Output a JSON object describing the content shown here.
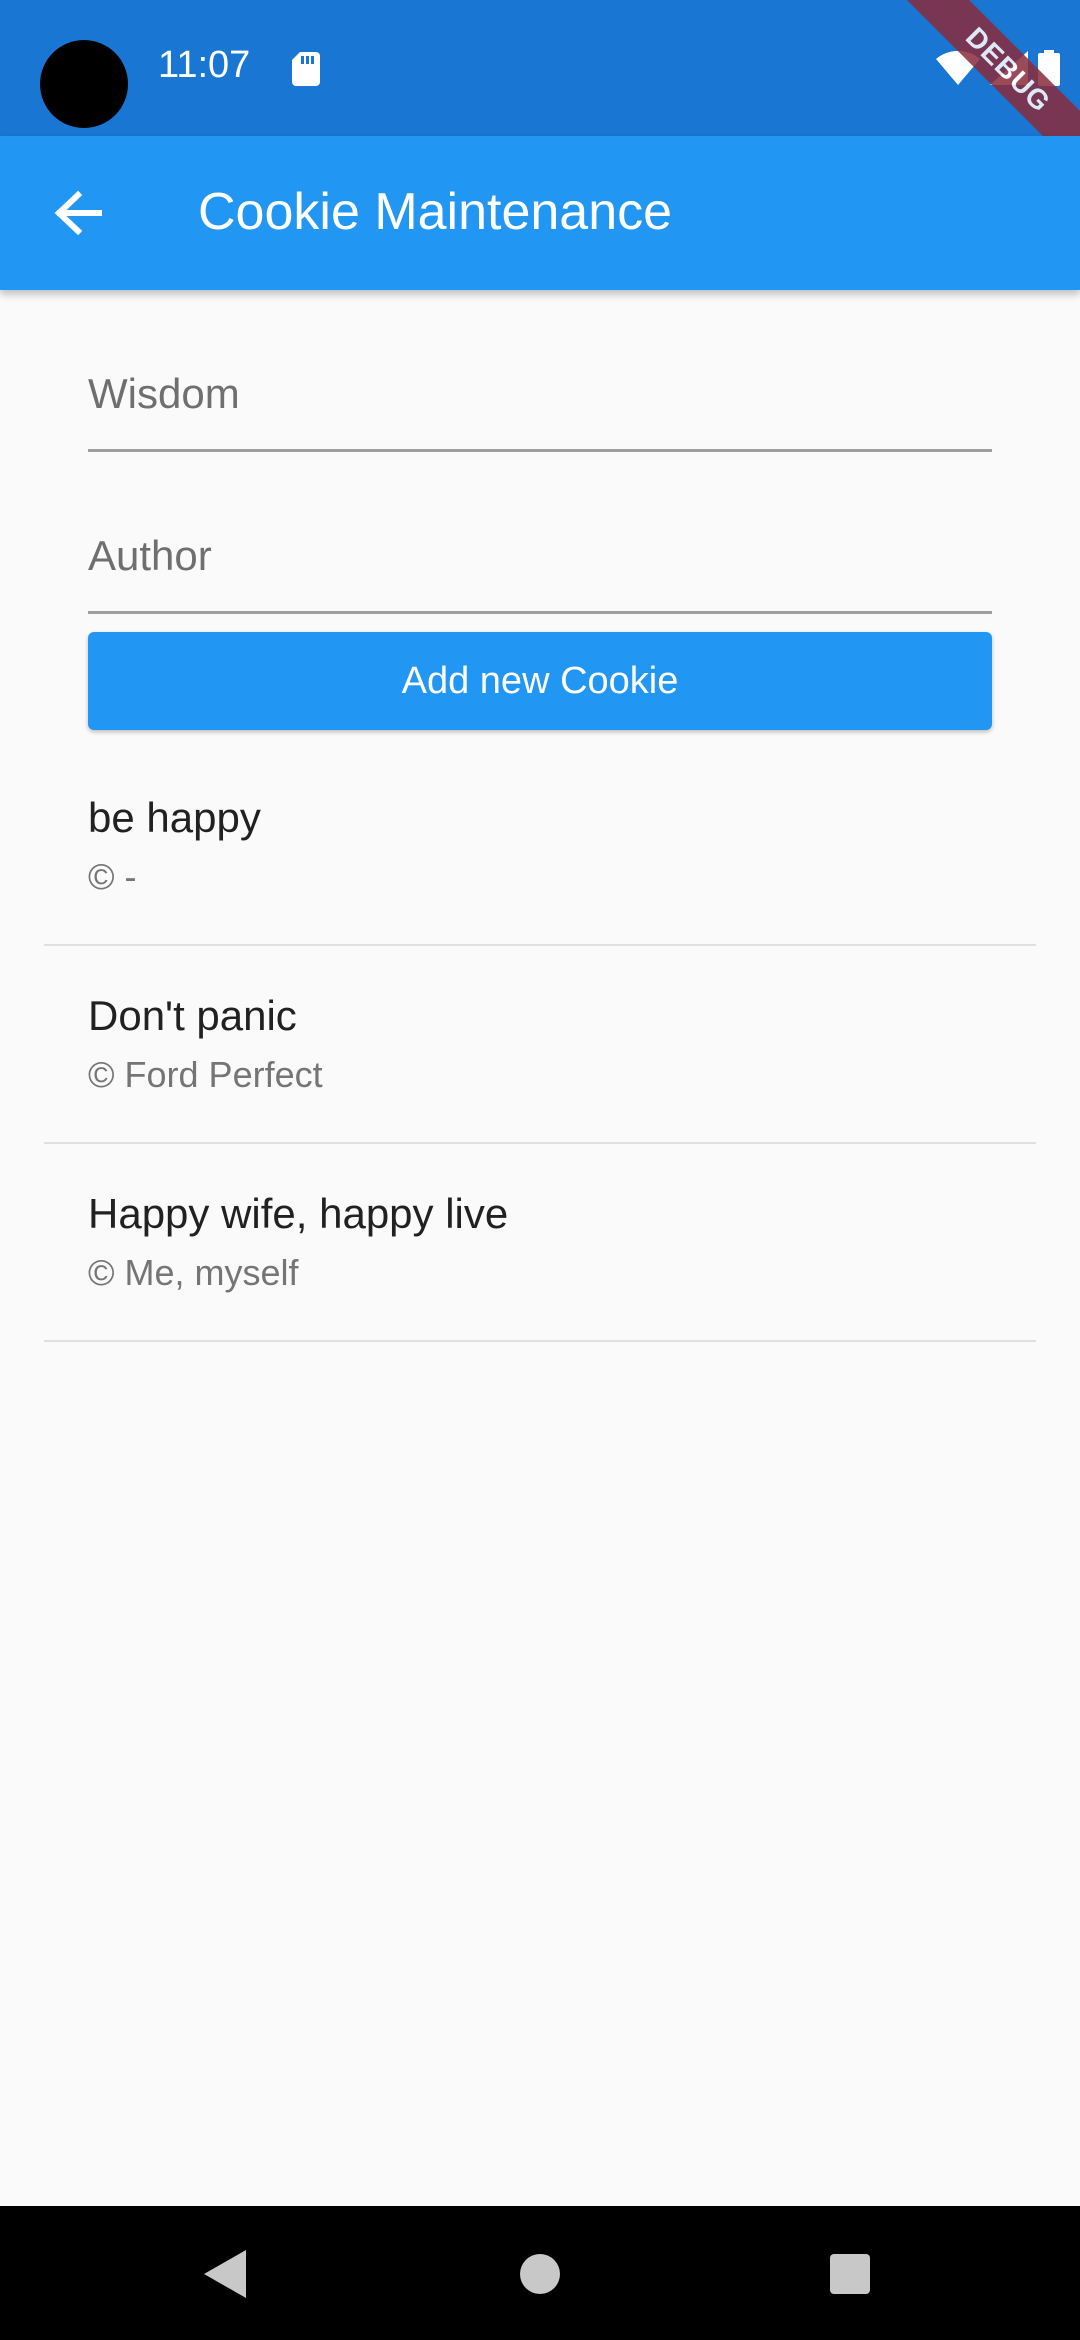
{
  "status_bar": {
    "time": "11:07",
    "icons": [
      "sd-card-icon",
      "wifi-icon",
      "signal-icon",
      "battery-icon"
    ],
    "debug_banner": "DEBUG"
  },
  "app_bar": {
    "title": "Cookie Maintenance",
    "back_icon": "arrow-back-icon",
    "color": "#2196f3"
  },
  "form": {
    "wisdom_placeholder": "Wisdom",
    "wisdom_value": "",
    "author_placeholder": "Author",
    "author_value": "",
    "add_button_label": "Add new Cookie"
  },
  "cookies": [
    {
      "wisdom": "be happy",
      "author": "© -"
    },
    {
      "wisdom": "Don't panic",
      "author": "© Ford Perfect"
    },
    {
      "wisdom": "Happy wife, happy live",
      "author": "© Me, myself"
    }
  ],
  "nav_bar": {
    "icons": [
      "nav-back-icon",
      "nav-home-icon",
      "nav-recents-icon"
    ]
  }
}
